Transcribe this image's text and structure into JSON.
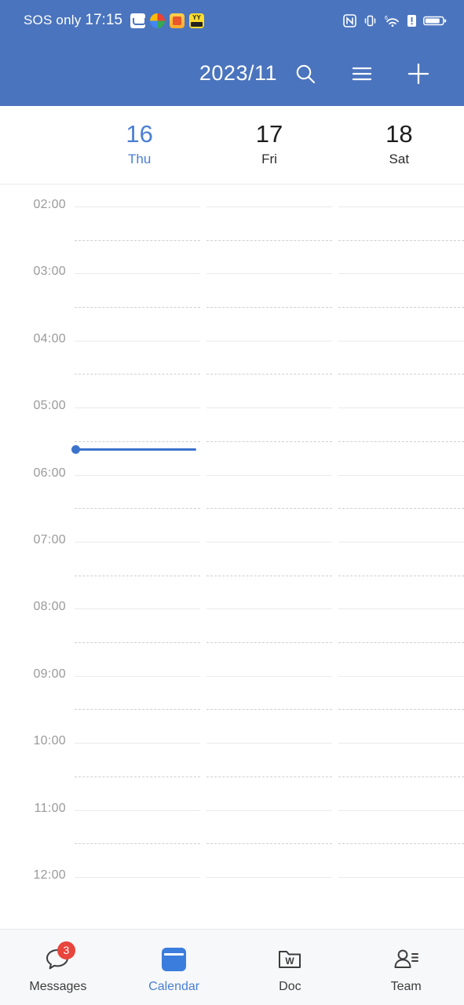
{
  "statusbar": {
    "carrier": "SOS only",
    "time": "17:15",
    "notification_icons": [
      "mail-icon",
      "pinwheel-icon",
      "app-icon",
      "yy-face-icon"
    ],
    "right_icons": [
      "nfc-icon",
      "vibrate-icon",
      "wifi-6-icon",
      "alert-icon",
      "battery-icon"
    ],
    "wifi_label": "6",
    "bar_color": "#4a74be"
  },
  "header": {
    "title": "2023/11",
    "search_icon": "search-icon",
    "menu_icon": "hamburger-menu-icon",
    "add_icon": "plus-icon",
    "bg_color": "#4a74be"
  },
  "days": [
    {
      "num": "16",
      "name": "Thu",
      "today": true
    },
    {
      "num": "17",
      "name": "Fri",
      "today": false
    },
    {
      "num": "18",
      "name": "Sat",
      "today": false
    }
  ],
  "grid": {
    "hours": [
      "02:00",
      "03:00",
      "04:00",
      "05:00",
      "06:00",
      "07:00",
      "08:00",
      "09:00",
      "10:00",
      "11:00",
      "12:00"
    ],
    "current_time_indicator": {
      "label": "17:15",
      "after_hour": "05:00",
      "column": "16",
      "color": "#3b73cc"
    }
  },
  "bottomnav": {
    "items": [
      {
        "label": "Messages",
        "icon": "chat-bubble-icon",
        "badge": "3",
        "active": false
      },
      {
        "label": "Calendar",
        "icon": "calendar-icon",
        "badge": "",
        "active": true
      },
      {
        "label": "Doc",
        "icon": "folder-w-icon",
        "badge": "",
        "active": false
      },
      {
        "label": "Team",
        "icon": "people-icon",
        "badge": "",
        "active": false
      }
    ],
    "accent_color": "#4a7fd4",
    "badge_color": "#e8453c"
  }
}
